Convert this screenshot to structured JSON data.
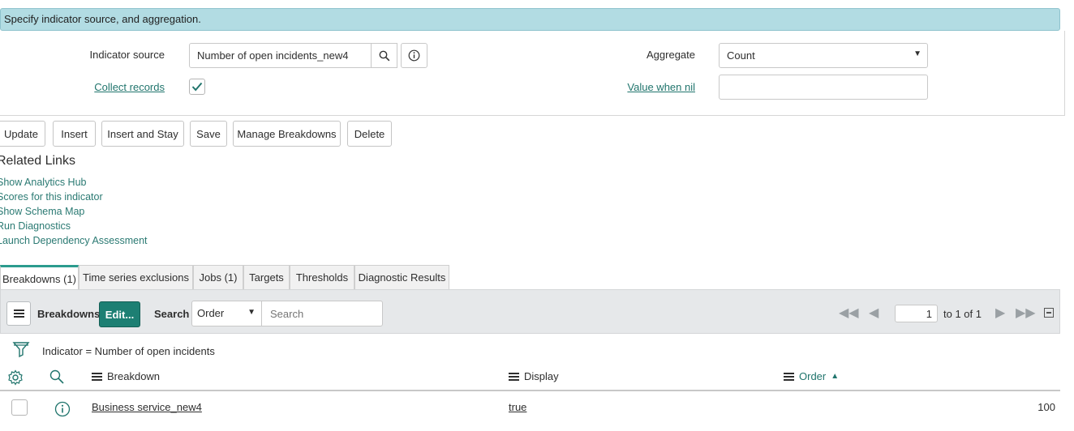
{
  "banner": {
    "text": "Specify indicator source, and aggregation."
  },
  "form": {
    "indicator_source_label": "Indicator source",
    "indicator_source_value": "Number of open incidents_new4",
    "collect_records_label": "Collect records",
    "collect_records_checked": true,
    "aggregate_label": "Aggregate",
    "aggregate_value": "Count",
    "value_when_nil_label": "Value when nil",
    "value_when_nil_value": ""
  },
  "actions": {
    "update": "Update",
    "insert": "Insert",
    "insert_and_stay": "Insert and Stay",
    "save": "Save",
    "manage_breakdowns": "Manage Breakdowns",
    "delete": "Delete"
  },
  "related_links": {
    "title": "Related Links",
    "items": [
      "Show Analytics Hub",
      "Scores for this indicator",
      "Show Schema Map",
      "Run Diagnostics",
      "Launch Dependency Assessment"
    ]
  },
  "tabs": [
    "Breakdowns (1)",
    "Time series exclusions",
    "Jobs (1)",
    "Targets",
    "Thresholds",
    "Diagnostic Results"
  ],
  "list": {
    "title": "Breakdowns",
    "edit_label": "Edit...",
    "search_label": "Search",
    "search_field_value": "Order",
    "search_placeholder": "Search",
    "page_current": "1",
    "page_text": "to 1 of 1",
    "filter_text": "Indicator = Number of open incidents",
    "columns": {
      "breakdown": "Breakdown",
      "display": "Display",
      "order": "Order"
    },
    "rows": [
      {
        "breakdown": "Business service_new4",
        "display": "true",
        "order": "100"
      }
    ]
  },
  "colors": {
    "accent": "#1d7f73",
    "link": "#21756d",
    "banner": "#b2dce3"
  }
}
